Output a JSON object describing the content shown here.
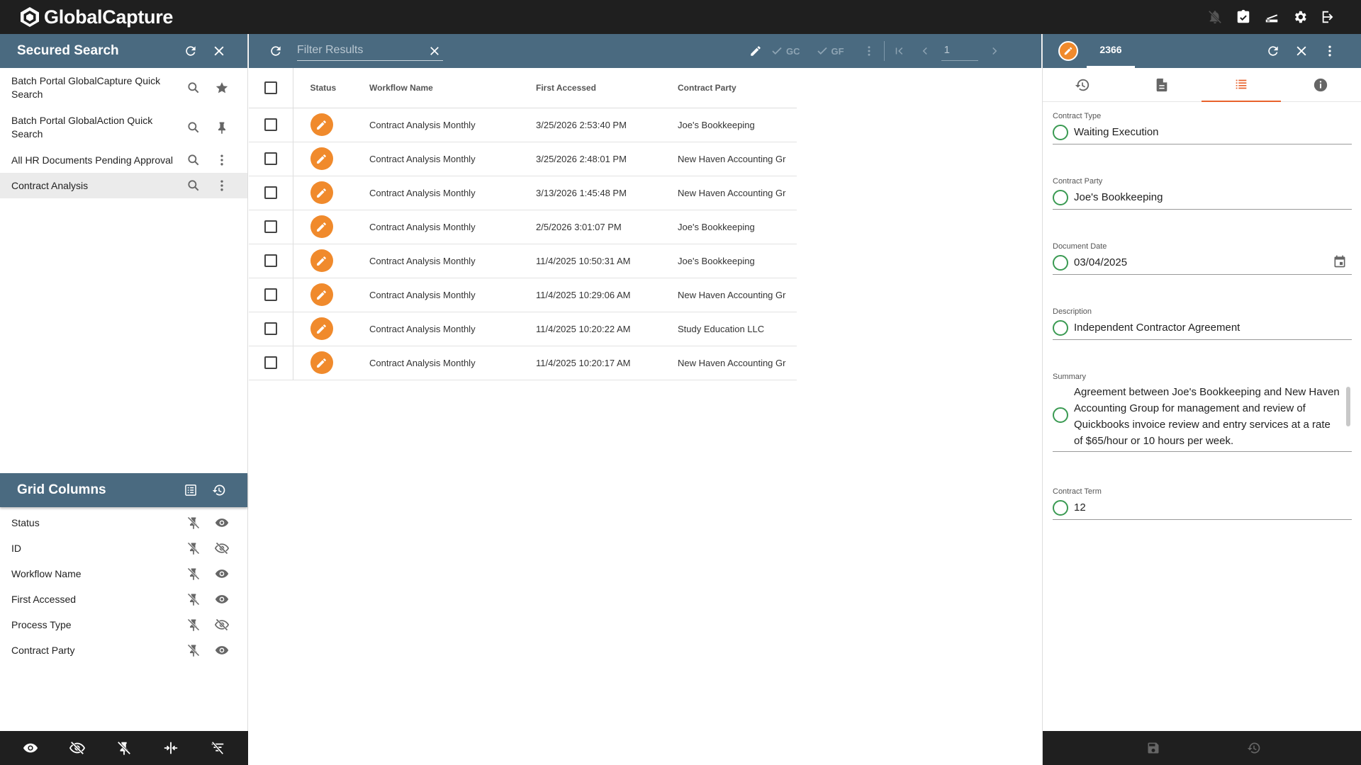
{
  "app": {
    "title": "GlobalCapture"
  },
  "topbar": {
    "icons": [
      "notifications-off-icon",
      "tasks-icon",
      "scanner-icon",
      "settings-icon",
      "logout-icon"
    ]
  },
  "secured_search": {
    "title": "Secured Search",
    "items": [
      {
        "label": "Batch Portal GlobalCapture Quick Search",
        "icon2": "star-icon",
        "selected": false
      },
      {
        "label": "Batch Portal GlobalAction Quick Search",
        "icon2": "pin-icon",
        "selected": false
      },
      {
        "label": "All HR Documents Pending Approval",
        "icon2": "more-vert-icon",
        "selected": false
      },
      {
        "label": "Contract Analysis",
        "icon2": "more-vert-icon",
        "selected": true
      }
    ]
  },
  "grid_columns": {
    "title": "Grid Columns",
    "columns": [
      {
        "label": "Status",
        "visible": true
      },
      {
        "label": "ID",
        "visible": false
      },
      {
        "label": "Workflow Name",
        "visible": true
      },
      {
        "label": "First Accessed",
        "visible": true
      },
      {
        "label": "Process Type",
        "visible": false
      },
      {
        "label": "Contract Party",
        "visible": true
      }
    ]
  },
  "results": {
    "filter_placeholder": "Filter Results",
    "tools": {
      "gc_label": "GC",
      "gf_label": "GF"
    },
    "page": "1",
    "headers": {
      "status": "Status",
      "workflow": "Workflow Name",
      "first_accessed": "First Accessed",
      "contract_party": "Contract Party"
    },
    "rows": [
      {
        "workflow": "Contract Analysis Monthly",
        "first_accessed": "3/25/2026 2:53:40 PM",
        "contract_party": "Joe's Bookkeeping"
      },
      {
        "workflow": "Contract Analysis Monthly",
        "first_accessed": "3/25/2026 2:48:01 PM",
        "contract_party": "New Haven Accounting Gr"
      },
      {
        "workflow": "Contract Analysis Monthly",
        "first_accessed": "3/13/2026 1:45:48 PM",
        "contract_party": "New Haven Accounting Gr"
      },
      {
        "workflow": "Contract Analysis Monthly",
        "first_accessed": "2/5/2026 3:01:07 PM",
        "contract_party": "Joe's Bookkeeping"
      },
      {
        "workflow": "Contract Analysis Monthly",
        "first_accessed": "11/4/2025 10:50:31 AM",
        "contract_party": "Joe's Bookkeeping"
      },
      {
        "workflow": "Contract Analysis Monthly",
        "first_accessed": "11/4/2025 10:29:06 AM",
        "contract_party": "New Haven Accounting Gr"
      },
      {
        "workflow": "Contract Analysis Monthly",
        "first_accessed": "11/4/2025 10:20:22 AM",
        "contract_party": "Study Education LLC"
      },
      {
        "workflow": "Contract Analysis Monthly",
        "first_accessed": "11/4/2025 10:20:17 AM",
        "contract_party": "New Haven Accounting Gr"
      }
    ]
  },
  "detail": {
    "id": "2366",
    "fields": {
      "contract_type": {
        "label": "Contract Type",
        "value": "Waiting Execution"
      },
      "contract_party": {
        "label": "Contract Party",
        "value": "Joe's Bookkeeping"
      },
      "document_date": {
        "label": "Document Date",
        "value": "03/04/2025"
      },
      "description": {
        "label": "Description",
        "value": "Independent Contractor Agreement"
      },
      "summary": {
        "label": "Summary",
        "value": "Agreement between Joe's Bookkeeping and New Haven Accounting Group for management and review of Quickbooks invoice review and entry services at a rate of $65/hour or 10 hours per week."
      },
      "contract_term": {
        "label": "Contract Term",
        "value": "12"
      }
    }
  },
  "colors": {
    "header": "#4a6a80",
    "dark": "#1f1f1f",
    "accent": "#f08a2c",
    "active_tab": "#e8622c",
    "field_ring": "#3a9a52"
  }
}
